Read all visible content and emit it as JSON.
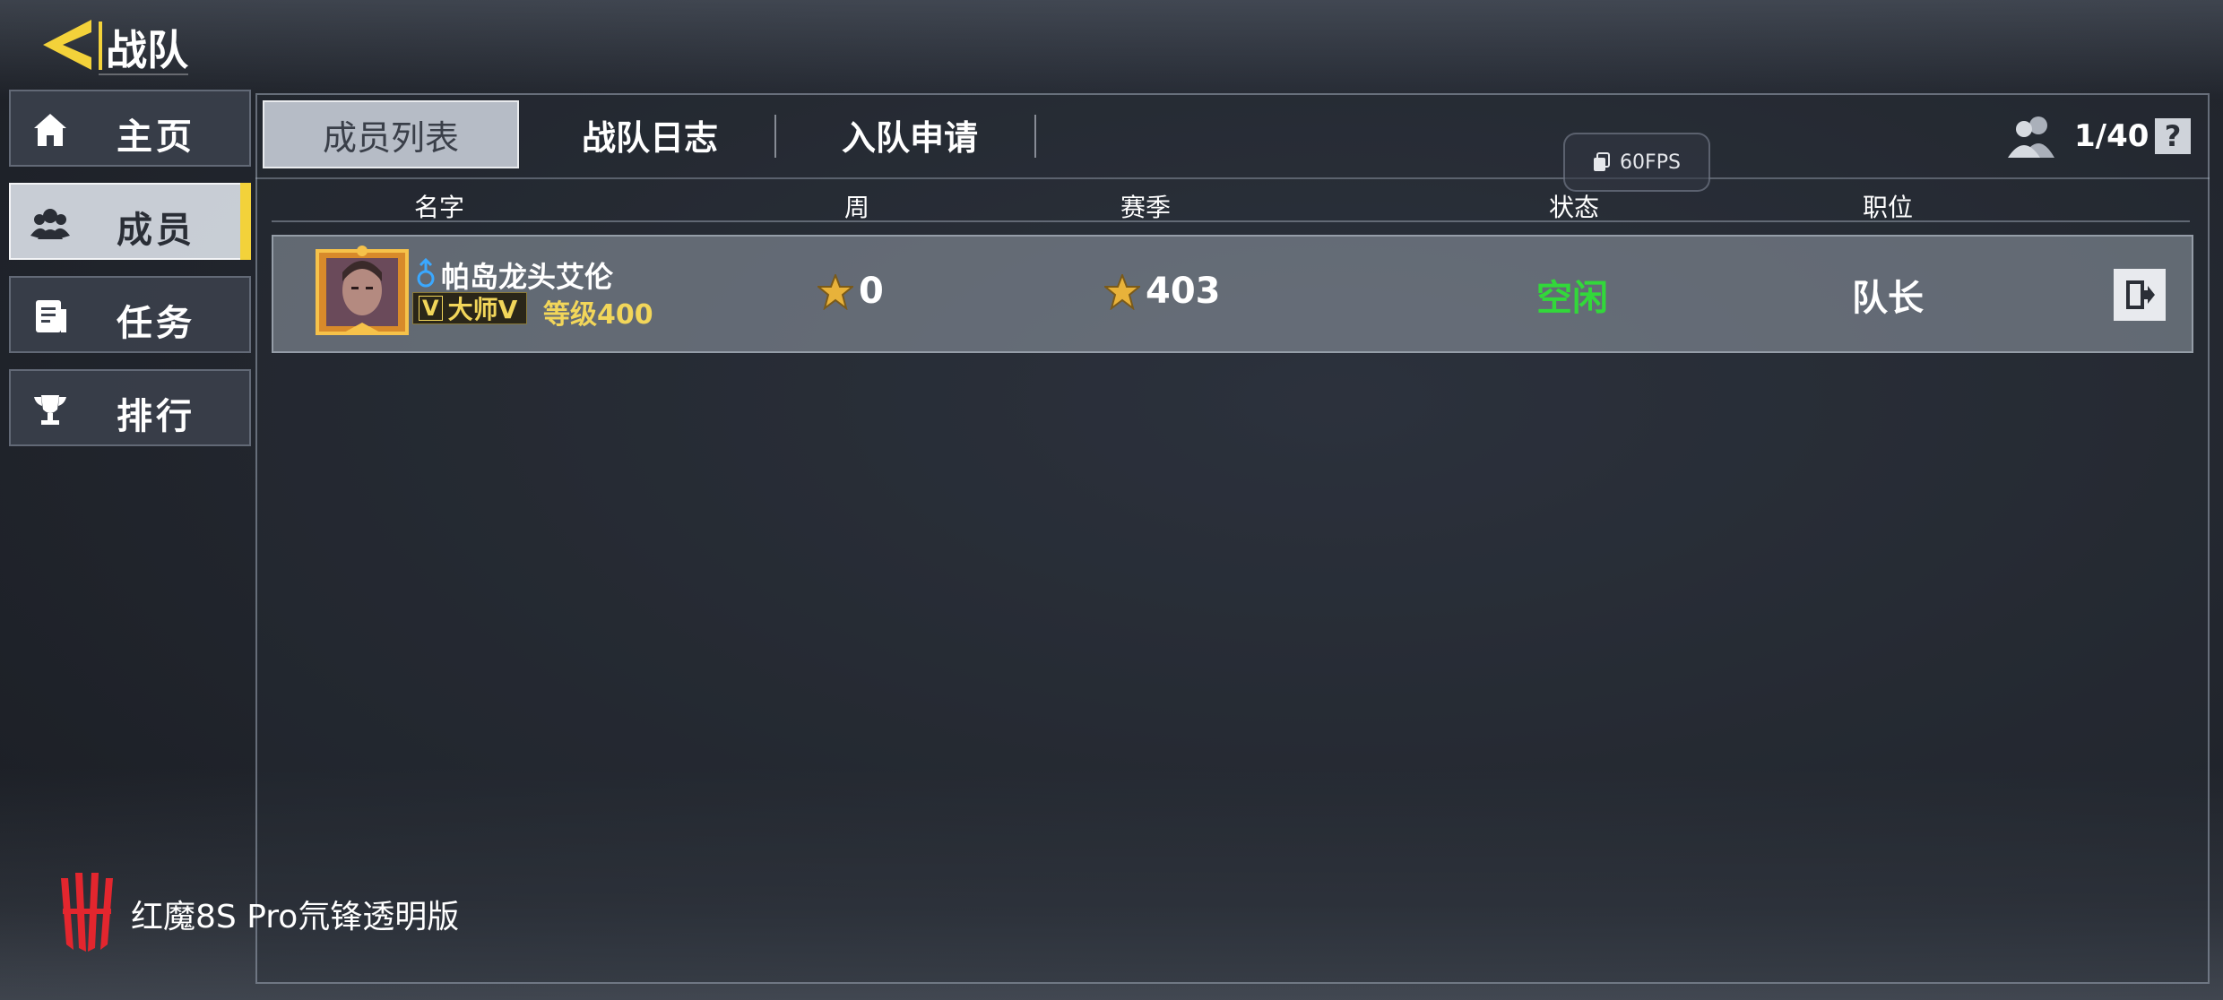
{
  "header": {
    "title": "战队"
  },
  "sidebar": {
    "items": [
      {
        "label": "主页",
        "icon": "home-icon"
      },
      {
        "label": "成员",
        "icon": "members-icon"
      },
      {
        "label": "任务",
        "icon": "task-icon"
      },
      {
        "label": "排行",
        "icon": "trophy-icon"
      }
    ],
    "active_index": 1
  },
  "tabs": [
    {
      "label": "成员列表"
    },
    {
      "label": "战队日志"
    },
    {
      "label": "入队申请"
    }
  ],
  "fps": {
    "label": "60FPS"
  },
  "member_count": "1/40",
  "help": {
    "label": "?"
  },
  "columns": {
    "name": "名字",
    "week": "周",
    "season": "赛季",
    "status": "状态",
    "role": "职位"
  },
  "members": [
    {
      "name": "帕岛龙头艾伦",
      "rank_letter": "V",
      "rank": "大师Ⅴ",
      "level": "等级400",
      "week": "0",
      "season": "403",
      "status": "空闲",
      "role": "队长"
    }
  ],
  "brand": {
    "text": "红魔8S Pro氘锋透明版"
  },
  "colors": {
    "accent": "#f3d23a",
    "status_idle": "#32d83a",
    "rank_gold": "#f2d65a"
  }
}
